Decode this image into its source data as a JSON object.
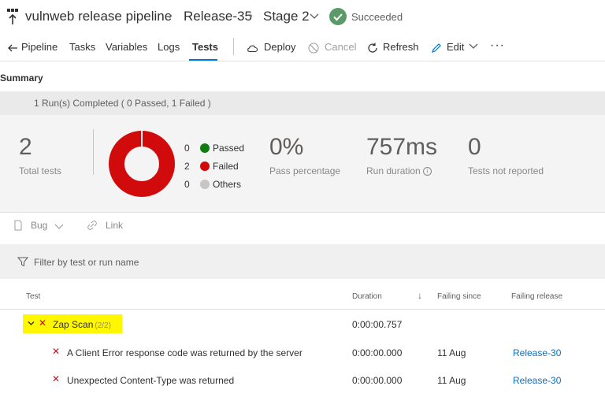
{
  "header": {
    "pipeline_name": "vulnweb release pipeline",
    "release": "Release-35",
    "stage": "Stage 2",
    "status": "Succeeded"
  },
  "toolbar": {
    "tabs": [
      "Pipeline",
      "Tasks",
      "Variables",
      "Logs",
      "Tests"
    ],
    "active_tab": "Tests",
    "actions": {
      "deploy": "Deploy",
      "cancel": "Cancel",
      "refresh": "Refresh",
      "edit": "Edit",
      "more": "···"
    }
  },
  "summary": {
    "title": "Summary",
    "band_text": "1 Run(s) Completed ( 0 Passed, 1 Failed )",
    "total_tests": "2",
    "total_tests_label": "Total tests",
    "legend": [
      {
        "count": "0",
        "label": "Passed",
        "color": "#107c10"
      },
      {
        "count": "2",
        "label": "Failed",
        "color": "#d10b0b"
      },
      {
        "count": "0",
        "label": "Others",
        "color": "#c8c6c4"
      }
    ],
    "pass_percentage": "0%",
    "pass_percentage_label": "Pass percentage",
    "run_duration": "757ms",
    "run_duration_label": "Run duration",
    "not_reported": "0",
    "not_reported_label": "Tests not reported"
  },
  "chart_data": {
    "type": "pie",
    "categories": [
      "Passed",
      "Failed",
      "Others"
    ],
    "values": [
      0,
      2,
      0
    ],
    "colors": [
      "#107c10",
      "#d10b0b",
      "#c8c6c4"
    ]
  },
  "actions": {
    "bug": "Bug",
    "link": "Link"
  },
  "filter": {
    "placeholder": "Filter by test or run name"
  },
  "table": {
    "columns": {
      "test": "Test",
      "duration": "Duration",
      "failing_since": "Failing since",
      "failing_release": "Failing release"
    },
    "group": {
      "name": "Zap Scan",
      "count": "(2/2)",
      "duration": "0:00:00.757"
    },
    "rows": [
      {
        "name": "A Client Error response code was returned by the server",
        "duration": "0:00:00.000",
        "failing_since": "11 Aug",
        "failing_release": "Release-30"
      },
      {
        "name": "Unexpected Content-Type was returned",
        "duration": "0:00:00.000",
        "failing_since": "11 Aug",
        "failing_release": "Release-30"
      }
    ]
  }
}
